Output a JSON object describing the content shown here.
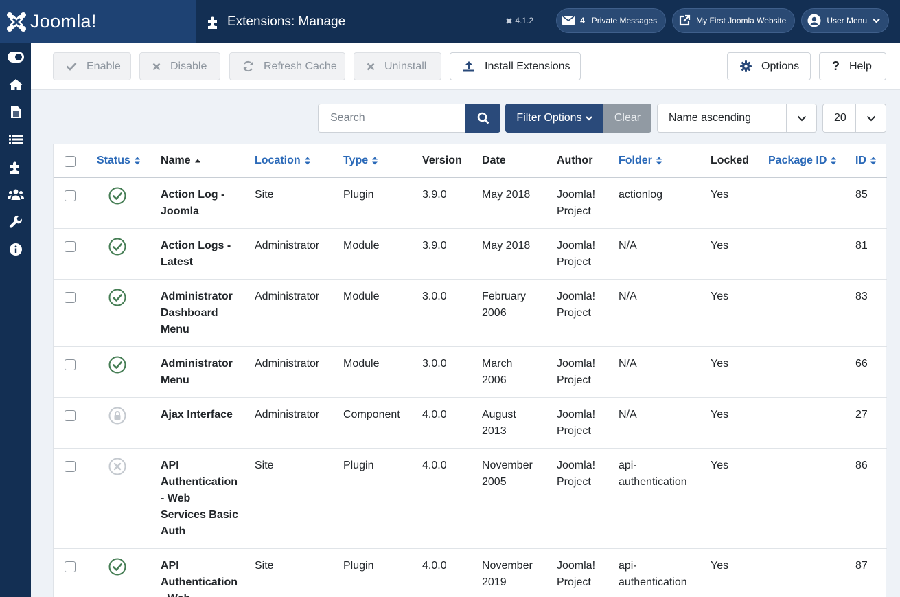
{
  "header": {
    "logo_text": "Joomla!",
    "page_title": "Extensions: Manage",
    "version": "4.1.2",
    "messages_count": "4",
    "messages_label": "Private Messages",
    "site_label": "My First Joomla Website",
    "user_menu_label": "User Menu"
  },
  "sidebar": {
    "icons": [
      "toggle-icon",
      "home-icon",
      "file-icon",
      "list-icon",
      "puzzle-icon",
      "users-icon",
      "wrench-icon",
      "info-icon"
    ]
  },
  "toolbar": {
    "enable": "Enable",
    "disable": "Disable",
    "refresh": "Refresh Cache",
    "uninstall": "Uninstall",
    "install": "Install Extensions",
    "options": "Options",
    "help": "Help"
  },
  "filters": {
    "search_placeholder": "Search",
    "filter_options": "Filter Options",
    "clear": "Clear",
    "sort_value": "Name ascending",
    "limit_value": "20"
  },
  "table": {
    "columns": {
      "status": "Status",
      "name": "Name",
      "location": "Location",
      "type": "Type",
      "version": "Version",
      "date": "Date",
      "author": "Author",
      "folder": "Folder",
      "locked": "Locked",
      "package_id": "Package ID",
      "id": "ID"
    },
    "rows": [
      {
        "status": "enabled",
        "name": [
          "Action Log -",
          "Joomla"
        ],
        "location": "Site",
        "type": "Plugin",
        "version": "3.9.0",
        "date": [
          "May 2018"
        ],
        "author": [
          "Joomla!",
          "Project"
        ],
        "folder": [
          "actionlog"
        ],
        "locked": "Yes",
        "package_id": "",
        "id": "85"
      },
      {
        "status": "enabled",
        "name": [
          "Action Logs -",
          "Latest"
        ],
        "location": "Administrator",
        "type": "Module",
        "version": "3.9.0",
        "date": [
          "May 2018"
        ],
        "author": [
          "Joomla!",
          "Project"
        ],
        "folder": [
          "N/A"
        ],
        "locked": "Yes",
        "package_id": "",
        "id": "81"
      },
      {
        "status": "enabled",
        "name": [
          "Administrator",
          "Dashboard",
          "Menu"
        ],
        "location": "Administrator",
        "type": "Module",
        "version": "3.0.0",
        "date": [
          "February",
          "2006"
        ],
        "author": [
          "Joomla!",
          "Project"
        ],
        "folder": [
          "N/A"
        ],
        "locked": "Yes",
        "package_id": "",
        "id": "83"
      },
      {
        "status": "enabled",
        "name": [
          "Administrator",
          "Menu"
        ],
        "location": "Administrator",
        "type": "Module",
        "version": "3.0.0",
        "date": [
          "March",
          "2006"
        ],
        "author": [
          "Joomla!",
          "Project"
        ],
        "folder": [
          "N/A"
        ],
        "locked": "Yes",
        "package_id": "",
        "id": "66"
      },
      {
        "status": "locked",
        "name": [
          "Ajax Interface"
        ],
        "location": "Administrator",
        "type": "Component",
        "version": "4.0.0",
        "date": [
          "August",
          "2013"
        ],
        "author": [
          "Joomla!",
          "Project"
        ],
        "folder": [
          "N/A"
        ],
        "locked": "Yes",
        "package_id": "",
        "id": "27"
      },
      {
        "status": "disabled",
        "name": [
          "API",
          "Authentication",
          "- Web",
          "Services Basic",
          "Auth"
        ],
        "location": "Site",
        "type": "Plugin",
        "version": "4.0.0",
        "date": [
          "November",
          "2005"
        ],
        "author": [
          "Joomla!",
          "Project"
        ],
        "folder": [
          "api-",
          "authentication"
        ],
        "locked": "Yes",
        "package_id": "",
        "id": "86"
      },
      {
        "status": "enabled",
        "name": [
          "API",
          "Authentication",
          "- Web"
        ],
        "location": "Site",
        "type": "Plugin",
        "version": "4.0.0",
        "date": [
          "November",
          "2019"
        ],
        "author": [
          "Joomla!",
          "Project"
        ],
        "folder": [
          "api-",
          "authentication"
        ],
        "locked": "Yes",
        "package_id": "",
        "id": "87"
      }
    ]
  },
  "colors": {
    "header_bg": "#132f53",
    "logo_bg": "#1e4273",
    "primary": "#2a4a7a",
    "link": "#2a69b8",
    "success": "#457d54"
  }
}
